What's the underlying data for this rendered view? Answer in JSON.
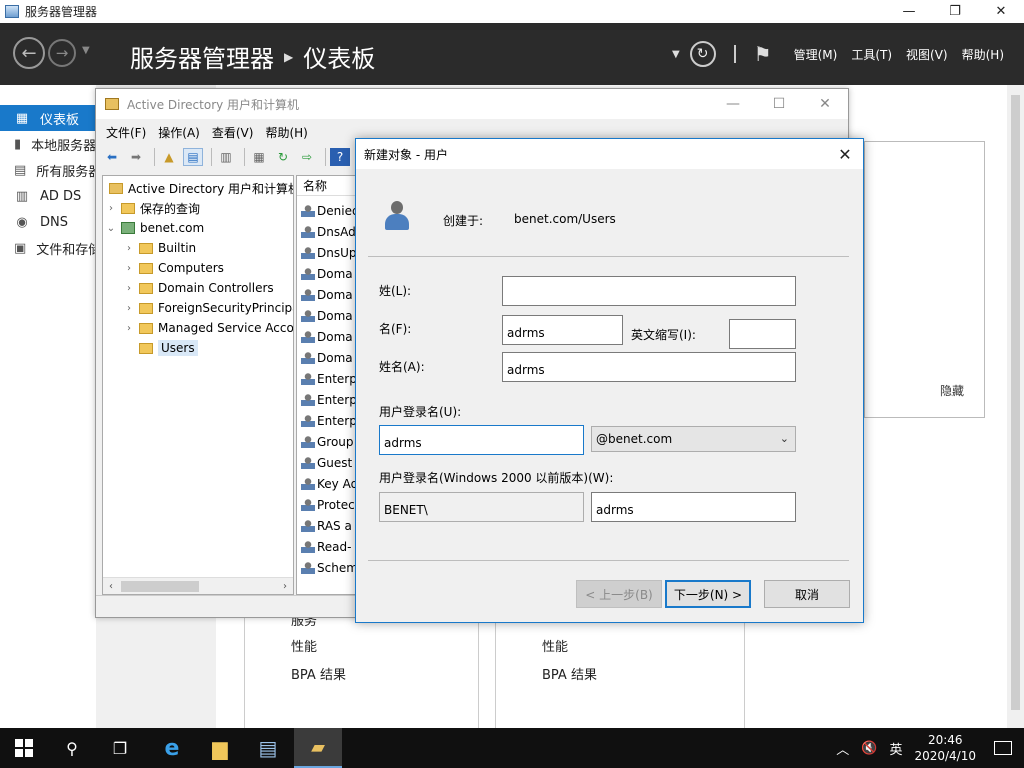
{
  "server_manager": {
    "title": "服务器管理器",
    "breadcrumb_root": "服务器管理器",
    "breadcrumb_page": "仪表板",
    "menus": [
      "管理(M)",
      "工具(T)",
      "视图(V)",
      "帮助(H)"
    ],
    "sidebar": [
      {
        "label": "仪表板",
        "icon": "dashboard-icon",
        "active": true
      },
      {
        "label": "本地服务器",
        "icon": "server-icon"
      },
      {
        "label": "所有服务器",
        "icon": "servers-icon"
      },
      {
        "label": "AD DS",
        "icon": "ad-ds-icon"
      },
      {
        "label": "DNS",
        "icon": "dns-icon"
      },
      {
        "label": "文件和存储服务",
        "icon": "file-storage-icon"
      }
    ],
    "tiles": [
      {
        "line0": "服务",
        "line1": "性能",
        "line2": "BPA 结果"
      },
      {
        "line1": "性能",
        "line2": "BPA 结果"
      }
    ],
    "hide_label": "隐藏"
  },
  "aduc": {
    "title": "Active Directory 用户和计算机",
    "menus": [
      "文件(F)",
      "操作(A)",
      "查看(V)",
      "帮助(H)"
    ],
    "tree": [
      {
        "label": "Active Directory 用户和计算机",
        "level": 0,
        "expander": ""
      },
      {
        "label": "保存的查询",
        "level": 1,
        "expander": "›"
      },
      {
        "label": "benet.com",
        "level": 1,
        "expander": "⌄"
      },
      {
        "label": "Builtin",
        "level": 2,
        "expander": "›"
      },
      {
        "label": "Computers",
        "level": 2,
        "expander": "›"
      },
      {
        "label": "Domain Controllers",
        "level": 2,
        "expander": "›"
      },
      {
        "label": "ForeignSecurityPrincipals",
        "level": 2,
        "expander": "›"
      },
      {
        "label": "Managed Service Accounts",
        "level": 2,
        "expander": "›"
      },
      {
        "label": "Users",
        "level": 2,
        "expander": "",
        "selected": true
      }
    ],
    "list_header": "名称",
    "list_items": [
      "Denied",
      "DnsAd",
      "DnsUp",
      "Doma",
      "Doma",
      "Doma",
      "Doma",
      "Doma",
      "Enterp",
      "Enterp",
      "Enterp",
      "Group",
      "Guest",
      "Key Ad",
      "Protec",
      "RAS a",
      "Read-",
      "Schem"
    ]
  },
  "dialog": {
    "title": "新建对象 - 用户",
    "created_label": "创建于:",
    "created_value": "benet.com/Users",
    "last_name_label": "姓(L):",
    "last_name_value": "",
    "first_name_label": "名(F):",
    "first_name_value": "adrms",
    "initials_label": "英文缩写(I):",
    "initials_value": "",
    "full_name_label": "姓名(A):",
    "full_name_value": "adrms",
    "logon_label": "用户登录名(U):",
    "logon_value": "adrms",
    "domain_value": "@benet.com",
    "pre2000_label": "用户登录名(Windows 2000 以前版本)(W):",
    "pre2000_domain": "BENET\\",
    "pre2000_value": "adrms",
    "back_button": "< 上一步(B)",
    "next_button": "下一步(N) >",
    "cancel_button": "取消"
  },
  "taskbar": {
    "ime": "英",
    "time": "20:46",
    "date": "2020/4/10"
  }
}
